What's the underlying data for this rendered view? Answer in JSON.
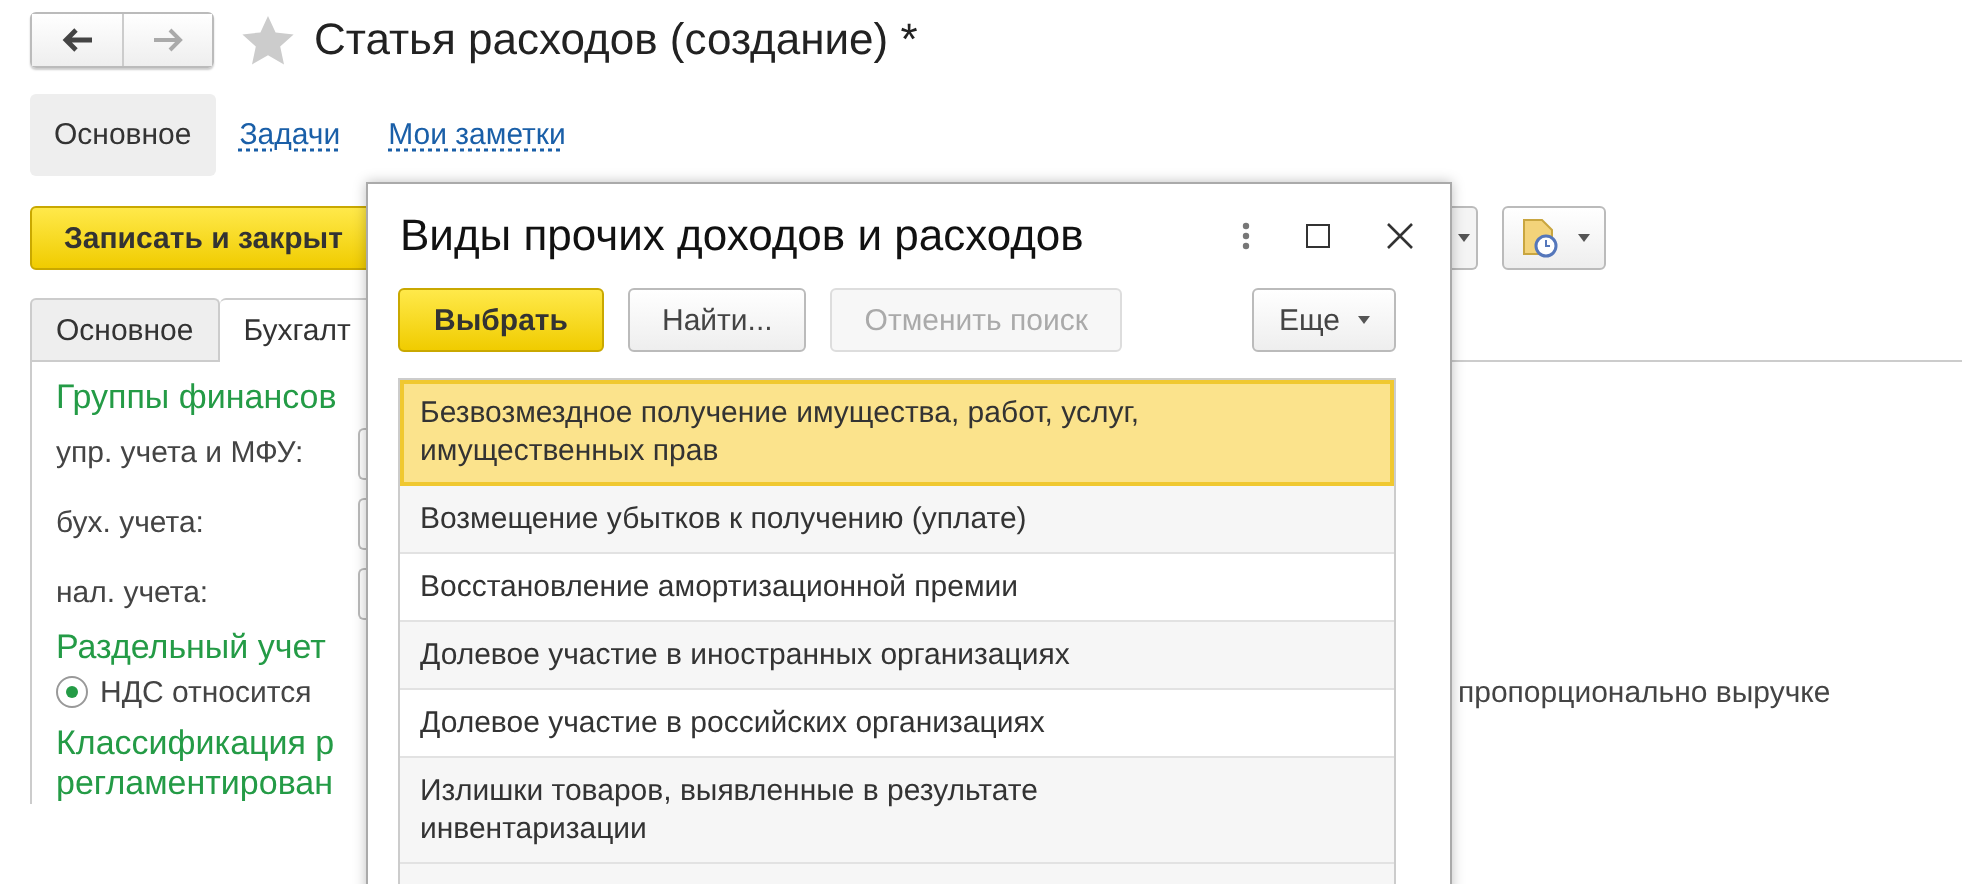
{
  "header": {
    "title": "Статья расходов (создание) *"
  },
  "nav_links": [
    {
      "label": "Основное",
      "selected": true
    },
    {
      "label": "Задачи",
      "selected": false
    },
    {
      "label": "Мои заметки",
      "selected": false
    }
  ],
  "toolbar": {
    "primary_button": "Записать и закрыт"
  },
  "tabs": [
    {
      "label": "Основное",
      "selected": false
    },
    {
      "label": "Бухгалт",
      "selected": true
    }
  ],
  "form": {
    "group_title": "Группы финансов",
    "fields": [
      {
        "label": "упр. учета и МФУ:"
      },
      {
        "label": "бух. учета:"
      },
      {
        "label": "нал. учета:"
      }
    ],
    "separate_title": "Раздельный учет",
    "radio": {
      "label": "НДС относится",
      "selected": true
    },
    "radio_tail": "пропорционально выручке",
    "classification_title": [
      "Классификация р",
      "регламентирован"
    ]
  },
  "dialog": {
    "title": "Виды прочих доходов и расходов",
    "buttons": [
      {
        "label": "Выбрать",
        "kind": "default"
      },
      {
        "label": "Найти...",
        "kind": "normal"
      },
      {
        "label": "Отменить поиск",
        "kind": "disabled"
      }
    ],
    "more_button": "Еще",
    "items": [
      {
        "label": "Безвозмездное получение имущества, работ, услуг, имущественных прав",
        "selected": true
      },
      {
        "label": "Возмещение убытков к получению (уплате)",
        "selected": false
      },
      {
        "label": "Восстановление амортизационной премии",
        "selected": false
      },
      {
        "label": "Долевое участие в иностранных организациях",
        "selected": false
      },
      {
        "label": "Долевое участие в российских организациях",
        "selected": false
      },
      {
        "label": "Излишки товаров, выявленные в результате инвентаризации",
        "selected": false
      }
    ]
  }
}
